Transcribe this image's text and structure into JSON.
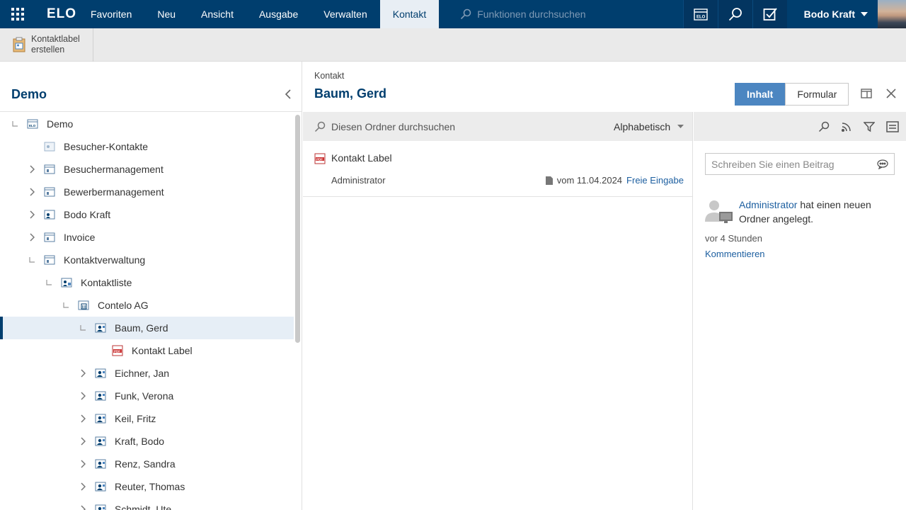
{
  "topbar": {
    "logo": "ELO",
    "menu": [
      "Favoriten",
      "Neu",
      "Ansicht",
      "Ausgabe",
      "Verwalten",
      "Kontakt"
    ],
    "active_menu": "Kontakt",
    "search_placeholder": "Funktionen durchsuchen",
    "user_name": "Bodo Kraft"
  },
  "toolbar": {
    "create_label": "Kontaktlabel\nerstellen"
  },
  "sidebar": {
    "title": "Demo",
    "tree": [
      {
        "label": "Demo",
        "level": 0,
        "toggle": "open",
        "icon": "archive-icon"
      },
      {
        "label": "Besucher-Kontakte",
        "level": 1,
        "toggle": "none",
        "icon": "contact-folder-icon"
      },
      {
        "label": "Besuchermanagement",
        "level": 1,
        "toggle": "closed",
        "icon": "folder-icon"
      },
      {
        "label": "Bewerbermanagement",
        "level": 1,
        "toggle": "closed",
        "icon": "folder-icon"
      },
      {
        "label": "Bodo Kraft",
        "level": 1,
        "toggle": "closed",
        "icon": "user-folder-icon"
      },
      {
        "label": "Invoice",
        "level": 1,
        "toggle": "closed",
        "icon": "folder-icon"
      },
      {
        "label": "Kontaktverwaltung",
        "level": 1,
        "toggle": "open",
        "icon": "folder-icon"
      },
      {
        "label": "Kontaktliste",
        "level": 2,
        "toggle": "open",
        "icon": "contact-list-icon"
      },
      {
        "label": "Contelo AG",
        "level": 3,
        "toggle": "open",
        "icon": "company-icon"
      },
      {
        "label": "Baum, Gerd",
        "level": 4,
        "toggle": "open",
        "icon": "contact-icon",
        "selected": true
      },
      {
        "label": "Kontakt Label",
        "level": 5,
        "toggle": "none",
        "icon": "pdf-icon"
      },
      {
        "label": "Eichner, Jan",
        "level": 4,
        "toggle": "closed",
        "icon": "contact-icon"
      },
      {
        "label": "Funk, Verona",
        "level": 4,
        "toggle": "closed",
        "icon": "contact-icon"
      },
      {
        "label": "Keil, Fritz",
        "level": 4,
        "toggle": "closed",
        "icon": "contact-icon"
      },
      {
        "label": "Kraft, Bodo",
        "level": 4,
        "toggle": "closed",
        "icon": "contact-icon"
      },
      {
        "label": "Renz, Sandra",
        "level": 4,
        "toggle": "closed",
        "icon": "contact-icon"
      },
      {
        "label": "Reuter, Thomas",
        "level": 4,
        "toggle": "closed",
        "icon": "contact-icon"
      },
      {
        "label": "Schmidt, Ute",
        "level": 4,
        "toggle": "closed",
        "icon": "contact-icon"
      }
    ]
  },
  "content": {
    "breadcrumb": "Kontakt",
    "title": "Baum, Gerd",
    "tab_content": "Inhalt",
    "tab_form": "Formular",
    "search_placeholder": "Diesen Ordner durchsuchen",
    "sort_label": "Alphabetisch",
    "entries": [
      {
        "title": "Kontakt Label",
        "author": "Administrator",
        "date": "vom 11.04.2024",
        "link": "Freie Eingabe"
      }
    ]
  },
  "feed": {
    "input_placeholder": "Schreiben Sie einen Beitrag",
    "item_user": "Administrator",
    "item_text": " hat einen neuen Ordner angelegt.",
    "item_time": "vor 4 Stunden",
    "item_action": "Kommentieren"
  },
  "colors": {
    "brand": "#003E6E",
    "accent": "#4C86C1",
    "link": "#1d5fa0"
  }
}
